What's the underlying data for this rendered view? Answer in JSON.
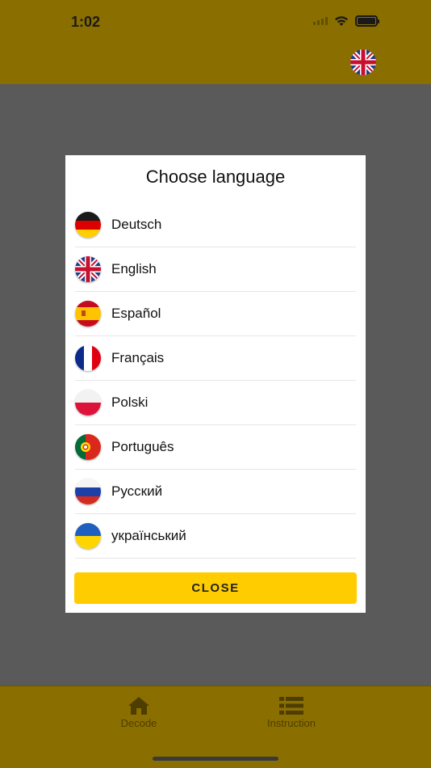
{
  "status_bar": {
    "time": "1:02"
  },
  "header": {
    "current_language_flag": "uk-flag-icon"
  },
  "modal": {
    "title": "Choose language",
    "languages": [
      {
        "label": "Deutsch",
        "flag": "germany-flag-icon"
      },
      {
        "label": "English",
        "flag": "uk-flag-icon"
      },
      {
        "label": "Español",
        "flag": "spain-flag-icon"
      },
      {
        "label": "Français",
        "flag": "france-flag-icon"
      },
      {
        "label": "Polski",
        "flag": "poland-flag-icon"
      },
      {
        "label": "Português",
        "flag": "portugal-flag-icon"
      },
      {
        "label": "Русский",
        "flag": "russia-flag-icon"
      },
      {
        "label": "український",
        "flag": "ukraine-flag-icon"
      }
    ],
    "close_label": "CLOSE"
  },
  "tabbar": {
    "tabs": [
      {
        "label": "Decode",
        "icon": "home-icon"
      },
      {
        "label": "Instruction",
        "icon": "list-icon"
      }
    ]
  },
  "colors": {
    "topbar": "#8a6e00",
    "overlay": "#5a5a5a",
    "close_button": "#ffcc00"
  }
}
